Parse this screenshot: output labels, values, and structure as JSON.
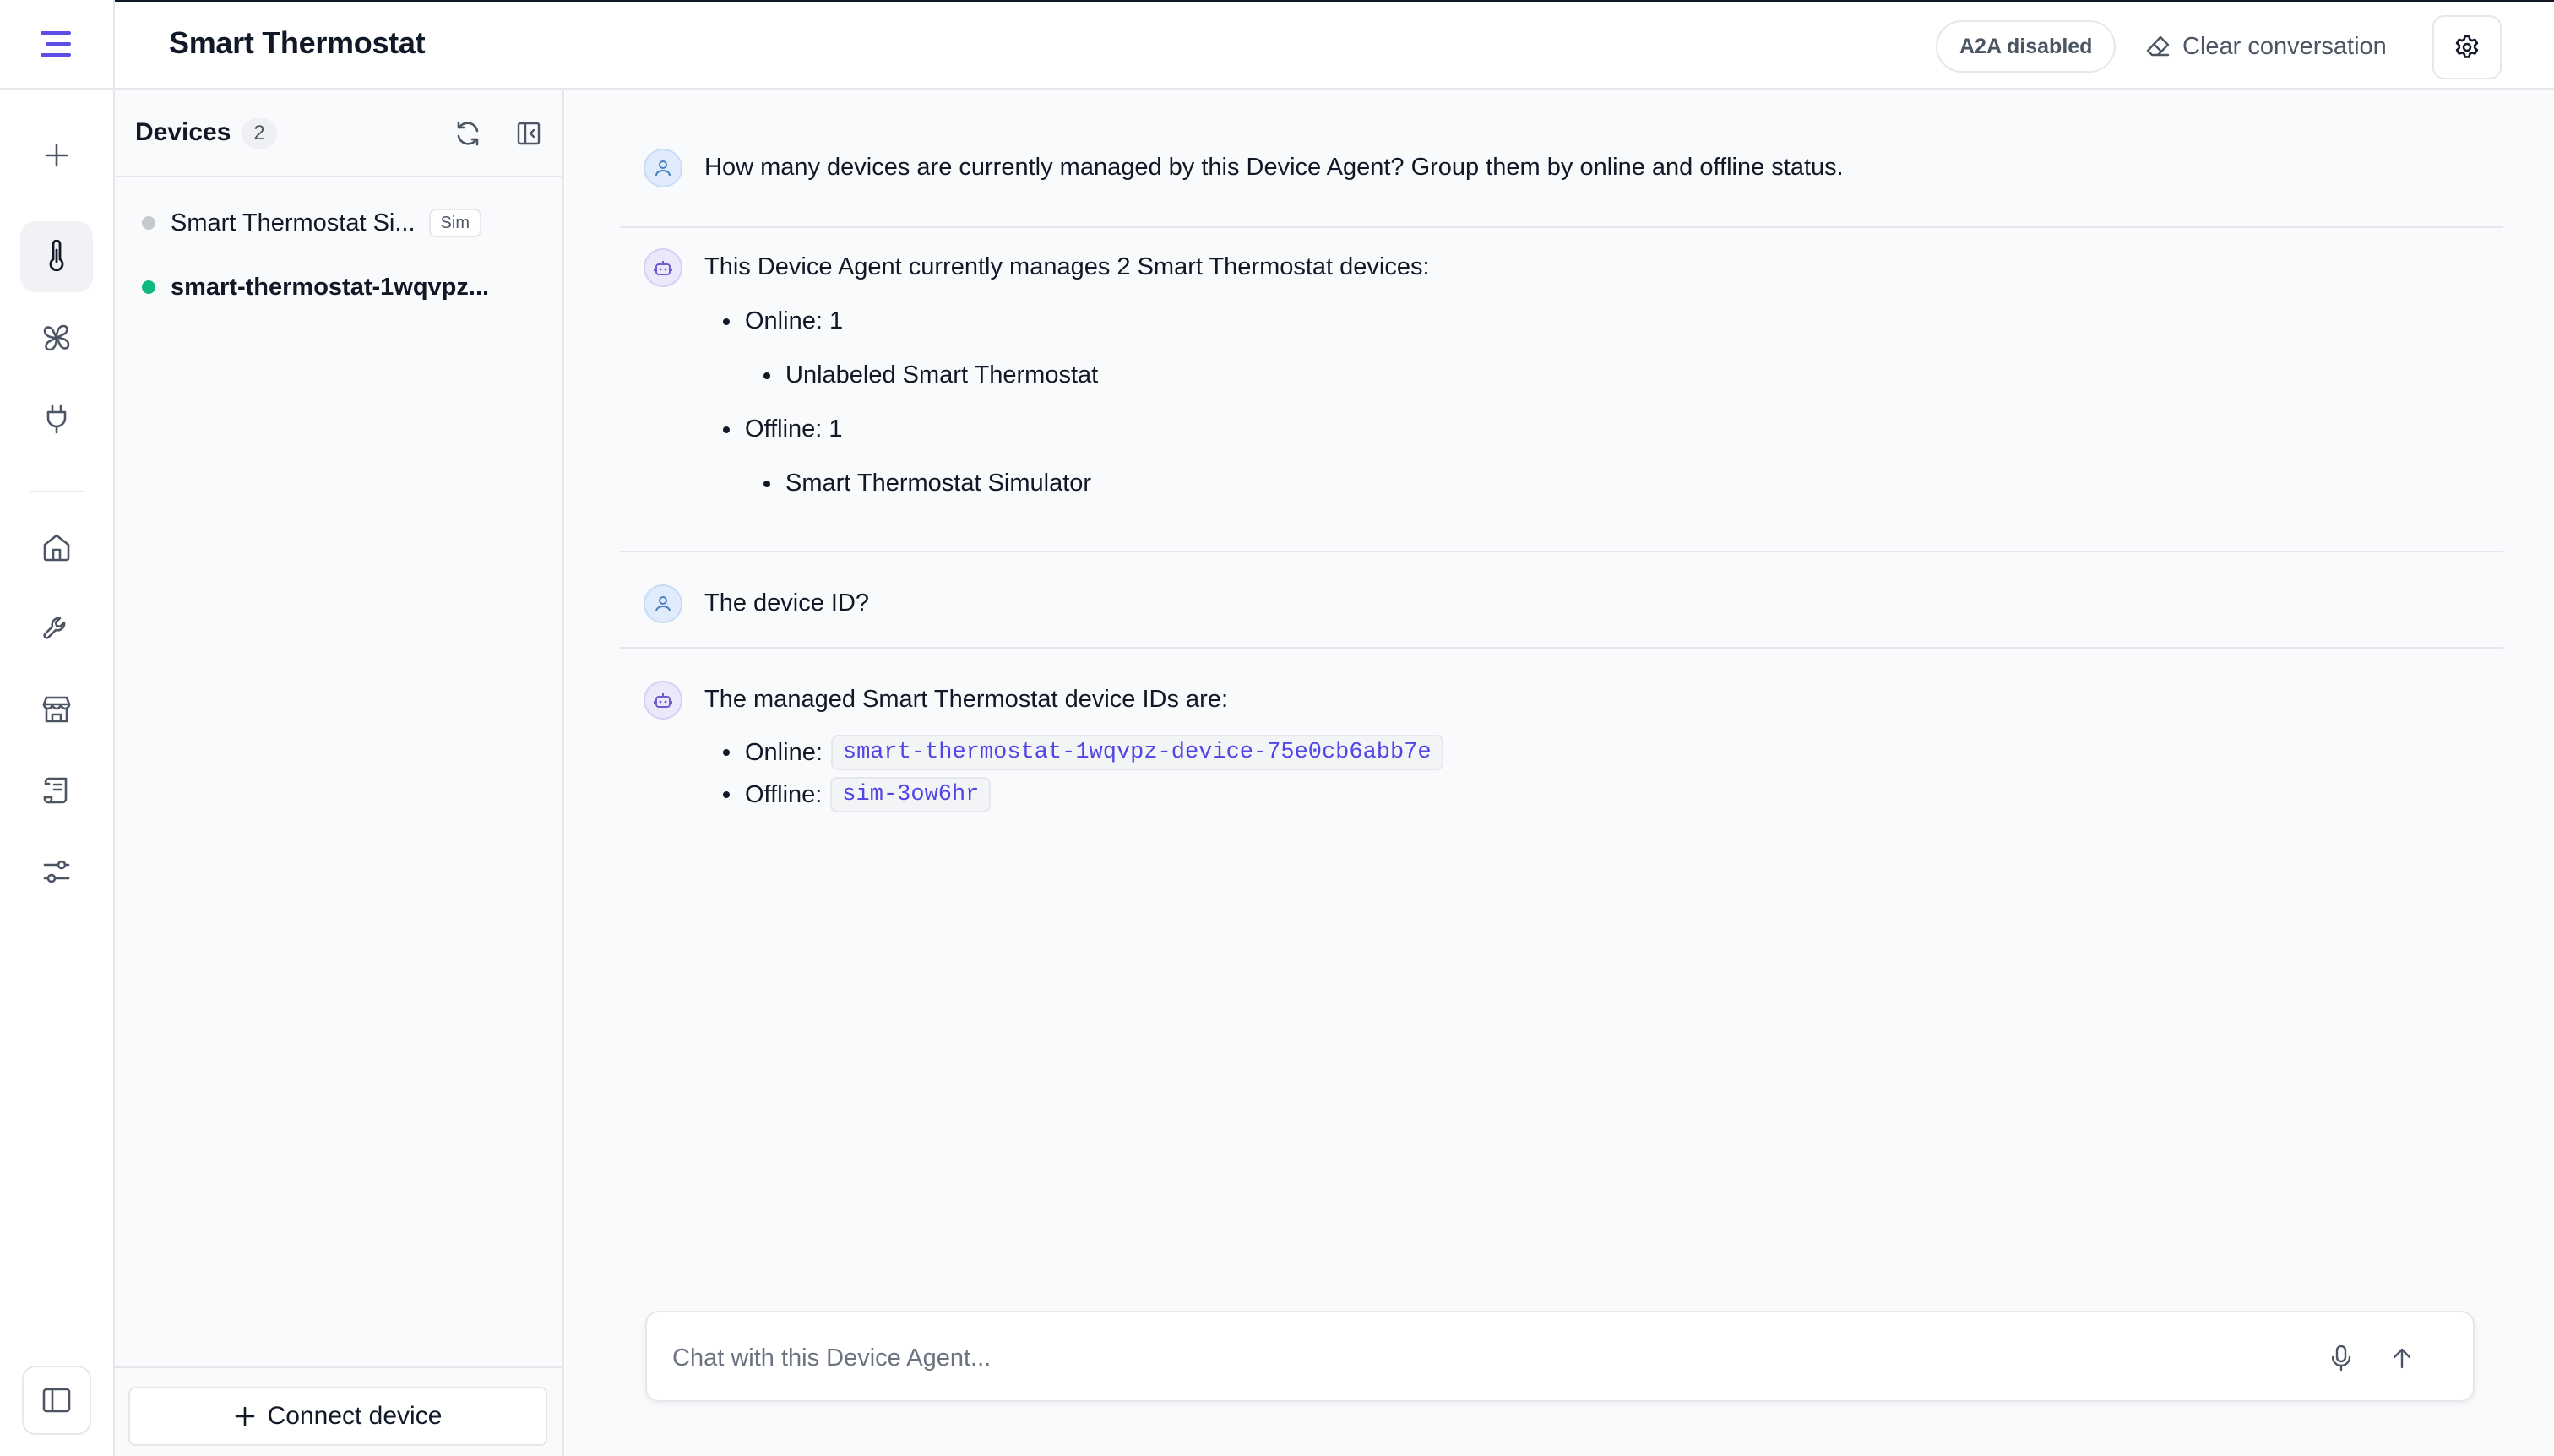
{
  "app": {
    "title": "Smart Thermostat"
  },
  "header": {
    "a2a_label": "A2A disabled",
    "clear_label": "Clear conversation"
  },
  "rail": {
    "icons": [
      "menu-icon",
      "plus-icon",
      "thermometer-icon",
      "fan-icon",
      "plug-icon",
      "home-icon",
      "wrench-icon",
      "store-icon",
      "scroll-icon",
      "sliders-icon",
      "sidebar-toggle-icon"
    ],
    "active": "thermometer-icon"
  },
  "devices": {
    "title": "Devices",
    "count": "2",
    "items": [
      {
        "name": "Smart Thermostat Si...",
        "status": "offline",
        "badge": "Sim"
      },
      {
        "name": "smart-thermostat-1wqvpz...",
        "status": "online"
      }
    ],
    "connect_label": "Connect device"
  },
  "colors": {
    "accent": "#5b4fe6",
    "online": "#10b981",
    "offline": "#c4c8cf",
    "code_text": "#4f46e5"
  },
  "chat": {
    "messages": [
      {
        "role": "user",
        "text": "How many devices are currently managed by this Device Agent? Group them by online and offline status."
      },
      {
        "role": "agent",
        "text": "This Device Agent currently manages 2 Smart Thermostat devices:",
        "bullets": [
          {
            "text": "Online: 1",
            "sub": "Unlabeled Smart Thermostat"
          },
          {
            "text": "Offline: 1",
            "sub": "Smart Thermostat Simulator"
          }
        ]
      },
      {
        "role": "user",
        "text": "The device ID?"
      },
      {
        "role": "agent",
        "text": "The managed Smart Thermostat device IDs are:",
        "ids": [
          {
            "label": "Online:",
            "code": "smart-thermostat-1wqvpz-device-75e0cb6abb7e"
          },
          {
            "label": "Offline:",
            "code": "sim-3ow6hr"
          }
        ]
      }
    ],
    "input_placeholder": "Chat with this Device Agent..."
  }
}
